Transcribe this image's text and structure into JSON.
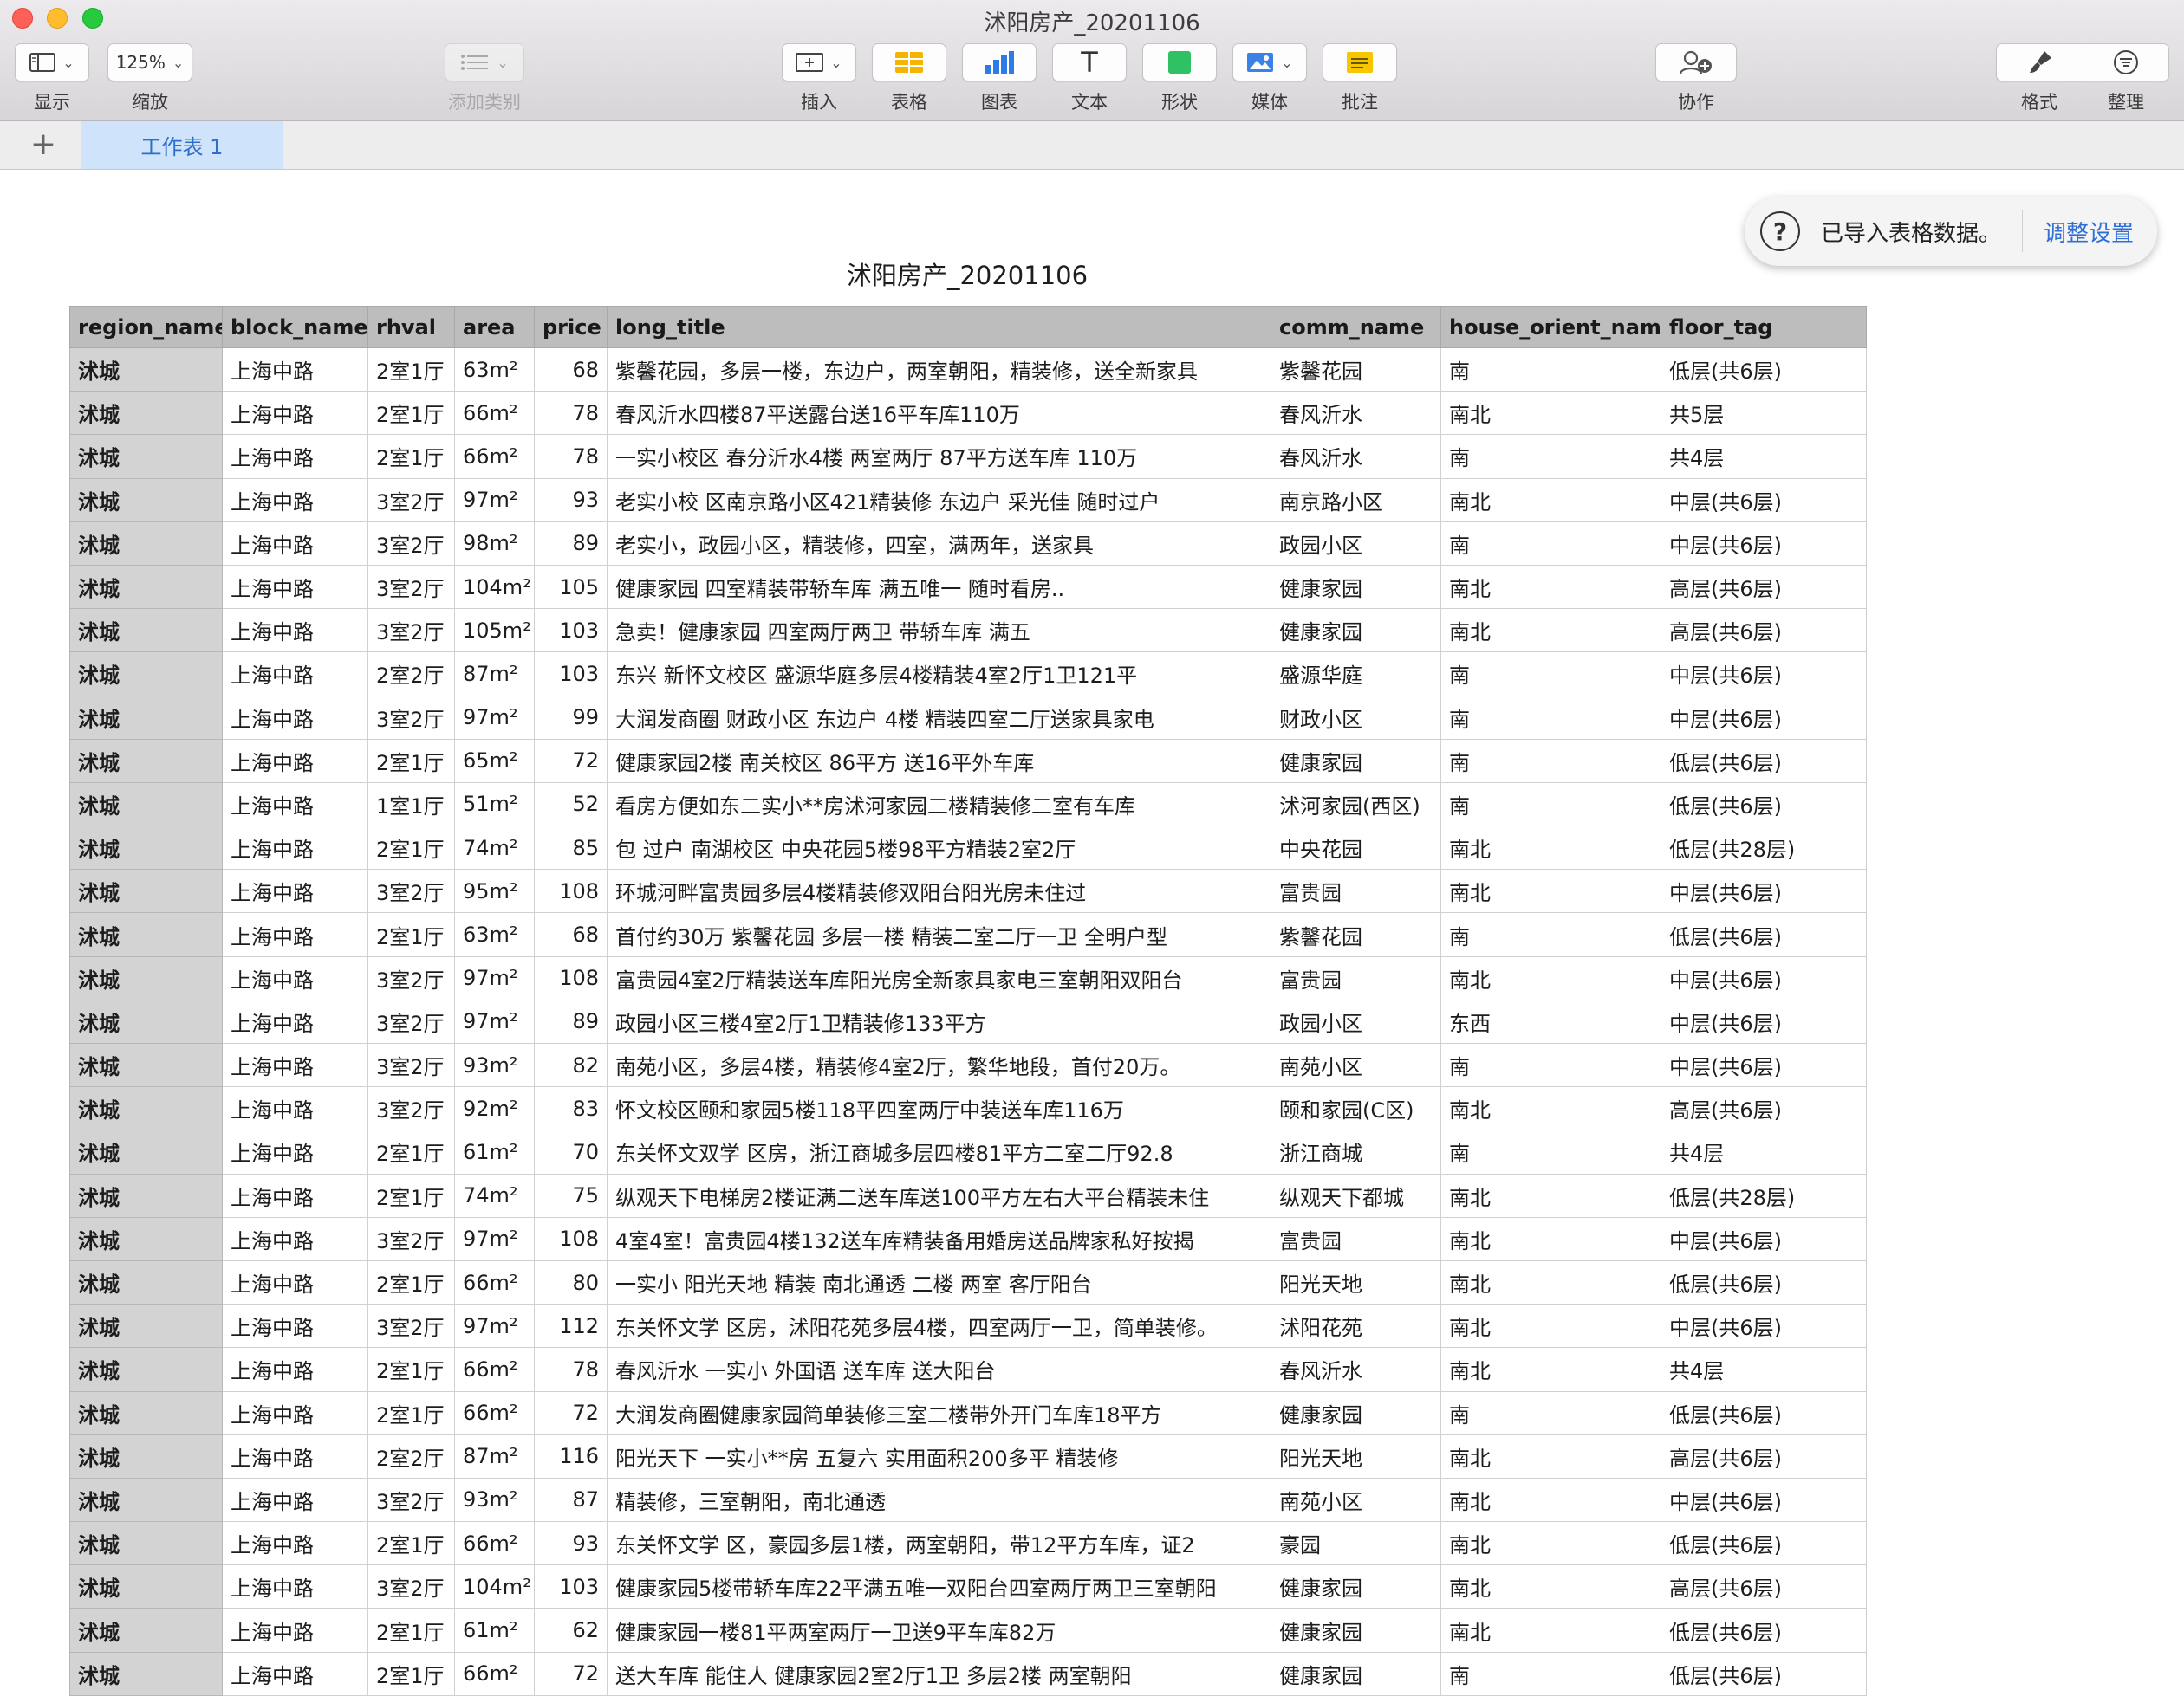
{
  "window": {
    "title": "沭阳房产_20201106"
  },
  "toolbar": {
    "view": {
      "label": "显示",
      "icon": "sidebar-view-icon"
    },
    "zoom": {
      "value": "125%",
      "label": "缩放"
    },
    "categories": {
      "label": "添加类别",
      "icon": "list-categories-icon"
    },
    "insert": {
      "label": "插入",
      "icon": "insert-icon"
    },
    "table": {
      "label": "表格",
      "icon": "table-icon",
      "color": "#f5b400"
    },
    "chart": {
      "label": "图表",
      "icon": "chart-icon",
      "color": "#2e7be6"
    },
    "text": {
      "label": "文本",
      "icon": "text-icon",
      "glyph": "T"
    },
    "shape": {
      "label": "形状",
      "icon": "shape-icon",
      "color": "#2fc163"
    },
    "media": {
      "label": "媒体",
      "icon": "media-icon",
      "color": "#3b82e6"
    },
    "comment": {
      "label": "批注",
      "icon": "comment-icon",
      "color": "#f6c600"
    },
    "collaborate": {
      "label": "协作",
      "icon": "collaborate-icon"
    },
    "format": {
      "label": "格式",
      "icon": "paintbrush-icon"
    },
    "organize": {
      "label": "整理",
      "icon": "organize-icon"
    }
  },
  "tabs": {
    "add_symbol": "+",
    "sheet": "工作表 1"
  },
  "notice": {
    "text": "已导入表格数据。",
    "link": "调整设置",
    "icon_glyph": "?"
  },
  "table": {
    "title": "沭阳房产_20201106",
    "columns": [
      "region_name",
      "block_name",
      "rhval",
      "area",
      "price",
      "long_title",
      "comm_name",
      "house_orient_name",
      "floor_tag"
    ],
    "rows": [
      [
        "沭城",
        "上海中路",
        "2室1厅",
        "63m²",
        "68",
        "紫馨花园，多层一楼，东边户，两室朝阳，精装修，送全新家具",
        "紫馨花园",
        "南",
        "低层(共6层)"
      ],
      [
        "沭城",
        "上海中路",
        "2室1厅",
        "66m²",
        "78",
        "春风沂水四楼87平送露台送16平车库110万",
        "春风沂水",
        "南北",
        "共5层"
      ],
      [
        "沭城",
        "上海中路",
        "2室1厅",
        "66m²",
        "78",
        "一实小校区 春分沂水4楼 两室两厅 87平方送车库 110万",
        "春风沂水",
        "南",
        "共4层"
      ],
      [
        "沭城",
        "上海中路",
        "3室2厅",
        "97m²",
        "93",
        "老实小校 区南京路小区421精装修 东边户 采光佳 随时过户",
        "南京路小区",
        "南北",
        "中层(共6层)"
      ],
      [
        "沭城",
        "上海中路",
        "3室2厅",
        "98m²",
        "89",
        "老实小，政园小区，精装修，四室，满两年，送家具",
        "政园小区",
        "南",
        "中层(共6层)"
      ],
      [
        "沭城",
        "上海中路",
        "3室2厅",
        "104m²",
        "105",
        "健康家园 四室精装带轿车库 满五唯一  随时看房..",
        "健康家园",
        "南北",
        "高层(共6层)"
      ],
      [
        "沭城",
        "上海中路",
        "3室2厅",
        "105m²",
        "103",
        "急卖！健康家园 四室两厅两卫 带轿车库 满五",
        "健康家园",
        "南北",
        "高层(共6层)"
      ],
      [
        "沭城",
        "上海中路",
        "2室2厅",
        "87m²",
        "103",
        "东兴 新怀文校区 盛源华庭多层4楼精装4室2厅1卫121平",
        "盛源华庭",
        "南",
        "中层(共6层)"
      ],
      [
        "沭城",
        "上海中路",
        "3室2厅",
        "97m²",
        "99",
        "大润发商圈 财政小区 东边户 4楼 精装四室二厅送家具家电",
        "财政小区",
        "南",
        "中层(共6层)"
      ],
      [
        "沭城",
        "上海中路",
        "2室1厅",
        "65m²",
        "72",
        "健康家园2楼 南关校区 86平方 送16平外车库",
        "健康家园",
        "南",
        "低层(共6层)"
      ],
      [
        "沭城",
        "上海中路",
        "1室1厅",
        "51m²",
        "52",
        "看房方便如东二实小**房沭河家园二楼精装修二室有车库",
        "沭河家园(西区)",
        "南",
        "低层(共6层)"
      ],
      [
        "沭城",
        "上海中路",
        "2室1厅",
        "74m²",
        "85",
        "包 过户 南湖校区 中央花园5楼98平方精装2室2厅",
        "中央花园",
        "南北",
        "低层(共28层)"
      ],
      [
        "沭城",
        "上海中路",
        "3室2厅",
        "95m²",
        "108",
        "环城河畔富贵园多层4楼精装修双阳台阳光房未住过",
        "富贵园",
        "南北",
        "中层(共6层)"
      ],
      [
        "沭城",
        "上海中路",
        "2室1厅",
        "63m²",
        "68",
        "首付约30万 紫馨花园 多层一楼 精装二室二厅一卫 全明户型",
        "紫馨花园",
        "南",
        "低层(共6层)"
      ],
      [
        "沭城",
        "上海中路",
        "3室2厅",
        "97m²",
        "108",
        "富贵园4室2厅精装送车库阳光房全新家具家电三室朝阳双阳台",
        "富贵园",
        "南北",
        "中层(共6层)"
      ],
      [
        "沭城",
        "上海中路",
        "3室2厅",
        "97m²",
        "89",
        "政园小区三楼4室2厅1卫精装修133平方",
        "政园小区",
        "东西",
        "中层(共6层)"
      ],
      [
        "沭城",
        "上海中路",
        "3室2厅",
        "93m²",
        "82",
        "南苑小区，多层4楼，精装修4室2厅，繁华地段，首付20万。",
        "南苑小区",
        "南",
        "中层(共6层)"
      ],
      [
        "沭城",
        "上海中路",
        "3室2厅",
        "92m²",
        "83",
        "怀文校区颐和家园5楼118平四室两厅中装送车库116万",
        "颐和家园(C区)",
        "南北",
        "高层(共6层)"
      ],
      [
        "沭城",
        "上海中路",
        "2室1厅",
        "61m²",
        "70",
        "东关怀文双学 区房，浙江商城多层四楼81平方二室二厅92.8",
        "浙江商城",
        "南",
        "共4层"
      ],
      [
        "沭城",
        "上海中路",
        "2室1厅",
        "74m²",
        "75",
        "纵观天下电梯房2楼证满二送车库送100平方左右大平台精装未住",
        "纵观天下都城",
        "南北",
        "低层(共28层)"
      ],
      [
        "沭城",
        "上海中路",
        "3室2厅",
        "97m²",
        "108",
        "4室4室！富贵园4楼132送车库精装备用婚房送品牌家私好按揭",
        "富贵园",
        "南北",
        "中层(共6层)"
      ],
      [
        "沭城",
        "上海中路",
        "2室1厅",
        "66m²",
        "80",
        "一实小 阳光天地 精装 南北通透 二楼  两室 客厅阳台",
        "阳光天地",
        "南北",
        "低层(共6层)"
      ],
      [
        "沭城",
        "上海中路",
        "3室2厅",
        "97m²",
        "112",
        "东关怀文学 区房，沭阳花苑多层4楼，四室两厅一卫，简单装修。",
        "沭阳花苑",
        "南北",
        "中层(共6层)"
      ],
      [
        "沭城",
        "上海中路",
        "2室1厅",
        "66m²",
        "78",
        "春风沂水 一实小 外国语 送车库 送大阳台",
        "春风沂水",
        "南北",
        "共4层"
      ],
      [
        "沭城",
        "上海中路",
        "2室1厅",
        "66m²",
        "72",
        "大润发商圈健康家园简单装修三室二楼带外开门车库18平方",
        "健康家园",
        "南",
        "低层(共6层)"
      ],
      [
        "沭城",
        "上海中路",
        "2室2厅",
        "87m²",
        "116",
        "阳光天下 一实小**房 五复六 实用面积200多平 精装修",
        "阳光天地",
        "南北",
        "高层(共6层)"
      ],
      [
        "沭城",
        "上海中路",
        "3室2厅",
        "93m²",
        "87",
        "精装修，三室朝阳，南北通透",
        "南苑小区",
        "南北",
        "中层(共6层)"
      ],
      [
        "沭城",
        "上海中路",
        "2室1厅",
        "66m²",
        "93",
        "东关怀文学 区，豪园多层1楼，两室朝阳，带12平方车库，证2",
        "豪园",
        "南北",
        "低层(共6层)"
      ],
      [
        "沭城",
        "上海中路",
        "3室2厅",
        "104m²",
        "103",
        "健康家园5楼带轿车库22平满五唯一双阳台四室两厅两卫三室朝阳",
        "健康家园",
        "南北",
        "高层(共6层)"
      ],
      [
        "沭城",
        "上海中路",
        "2室1厅",
        "61m²",
        "62",
        "健康家园一楼81平两室两厅一卫送9平车库82万",
        "健康家园",
        "南北",
        "低层(共6层)"
      ],
      [
        "沭城",
        "上海中路",
        "2室1厅",
        "66m²",
        "72",
        "送大车库 能住人 健康家园2室2厅1卫 多层2楼 两室朝阳",
        "健康家园",
        "南",
        "低层(共6层)"
      ]
    ]
  }
}
